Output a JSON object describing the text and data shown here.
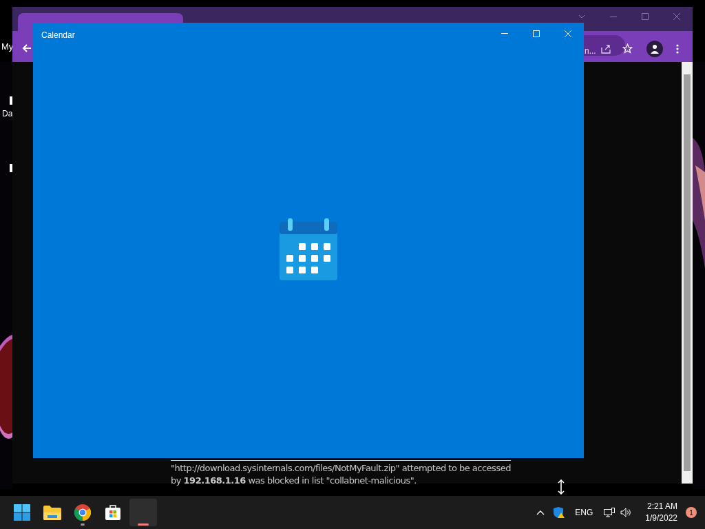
{
  "desktop": {
    "labels": [
      "My",
      "Da"
    ]
  },
  "browser": {
    "address_fragment": "n..."
  },
  "calendar_window": {
    "title": "Calendar"
  },
  "blocked_message": {
    "text": "\"http://download.sysinternals.com/files/NotMyFault.zip\" attempted to be accessed by **192.168.1.16** was blocked in list \"collabnet-malicious\"."
  },
  "taskbar": {
    "apps": [
      {
        "kind": "start",
        "running": false,
        "active": false
      },
      {
        "kind": "explorer",
        "running": false,
        "active": false
      },
      {
        "kind": "chrome",
        "running": true,
        "active": false
      },
      {
        "kind": "store",
        "running": false,
        "active": false
      },
      {
        "kind": "blank",
        "running": true,
        "active": true
      }
    ],
    "tray": {
      "language": "ENG",
      "time": "2:21 AM",
      "date": "1/9/2022",
      "notification_count": "1"
    }
  }
}
